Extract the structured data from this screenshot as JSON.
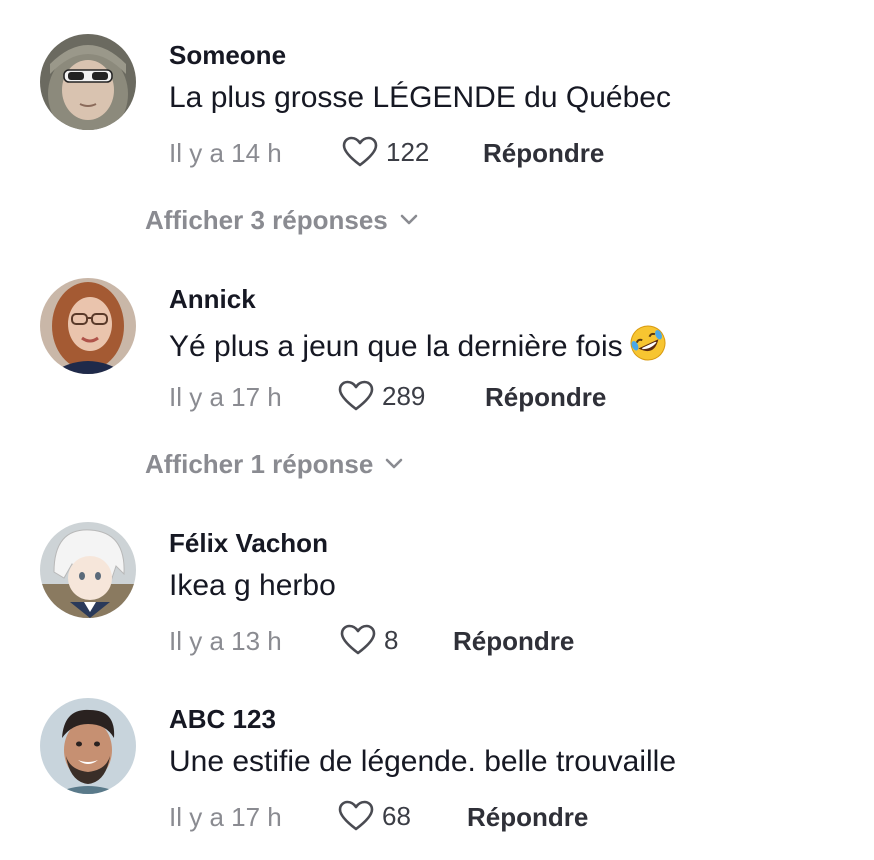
{
  "comments": [
    {
      "username": "Someone",
      "text": "La plus grosse LÉGENDE du Québec",
      "time": "Il y a 14 h",
      "likes": "122",
      "reply_label": "Répondre",
      "show_replies_label": "Afficher 3 réponses",
      "avatar_icon": "avatar-hooded-person-sunglasses"
    },
    {
      "username": "Annick",
      "text": "Yé plus a jeun que la dernière fois",
      "emoji": "rolling-on-floor-laughing-emoji",
      "time": "Il y a 17 h",
      "likes": "289",
      "reply_label": "Répondre",
      "show_replies_label": "Afficher 1 réponse",
      "avatar_icon": "avatar-woman-glasses"
    },
    {
      "username": "Félix Vachon",
      "text": "Ikea g herbo",
      "time": "Il y a 13 h",
      "likes": "8",
      "reply_label": "Répondre",
      "avatar_icon": "avatar-anime-character"
    },
    {
      "username": "ABC 123",
      "text": "Une estifie de légende. belle trouvaille",
      "time": "Il y a 17 h",
      "likes": "68",
      "reply_label": "Répondre",
      "avatar_icon": "avatar-smiling-man"
    }
  ],
  "colors": {
    "text_primary": "#161823",
    "text_secondary": "#8a8b91",
    "background": "#ffffff"
  }
}
